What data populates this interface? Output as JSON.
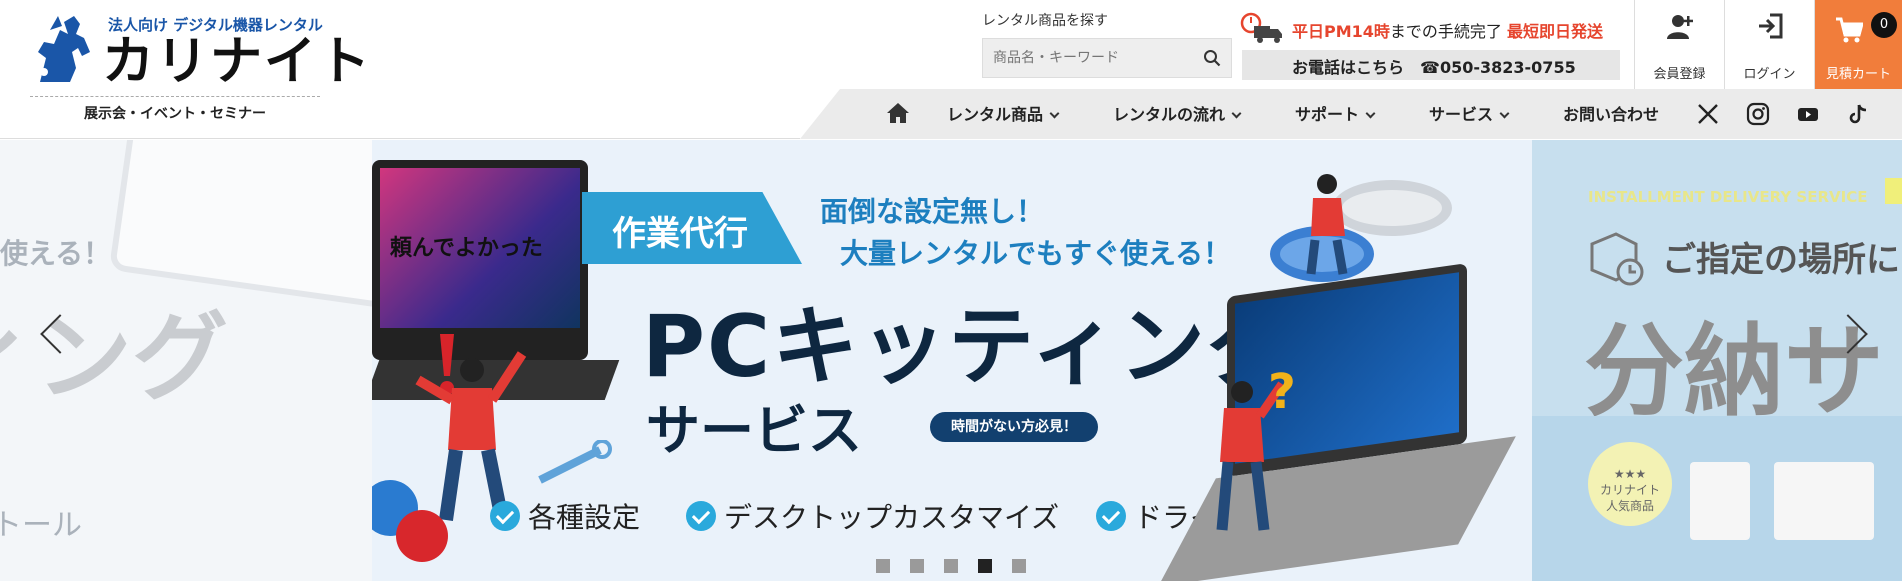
{
  "header": {
    "logo_tagline": "法人向け デジタル機器レンタル",
    "logo_name": "カリナイト",
    "logo_sub": "展示会・イベント・セミナー",
    "search": {
      "label": "レンタル商品を探す",
      "placeholder": "商品名・キーワード"
    },
    "shipping": {
      "part1": "平日PM14時",
      "part2": "までの手続完了",
      "part3": "最短即日発送"
    },
    "phone": {
      "label": "お電話はこちら",
      "number": "☎050-3823-0755"
    },
    "buttons": {
      "register": "会員登録",
      "login": "ログイン",
      "cart": "見積カート",
      "cart_count": "0"
    }
  },
  "nav": {
    "items": [
      "レンタル商品",
      "レンタルの流れ",
      "サポート",
      "サービス",
      "お問い合わせ"
    ],
    "social": [
      "x-icon",
      "instagram-icon",
      "youtube-icon",
      "tiktok-icon"
    ]
  },
  "slider": {
    "left": {
      "text_top": "使える！",
      "text_big": "ィング",
      "text_bottom": "トール"
    },
    "main": {
      "laptop_text": "頼んでよかった",
      "ribbon": "作業代行",
      "sub1": "面倒な設定無し！",
      "sub2": "大量レンタルでもすぐ使える！",
      "title": "PCキッティング",
      "title2": "サービス",
      "pill": "時間がない方必見！",
      "features": [
        "各種設定",
        "デスクトップカスタマイズ",
        "ドライバインストール"
      ]
    },
    "right": {
      "eyebrow": "INSTALLMENT DELIVERY SERVICE",
      "line1": "ご指定の場所に",
      "big": "分納サ",
      "badge_stars": "★★★",
      "badge_line1": "カリナイト",
      "badge_line2": "人気商品"
    },
    "dot_count": 5,
    "active_dot": 4
  },
  "colors": {
    "accent_orange": "#f17d3b",
    "accent_red": "#e6452e",
    "brand_blue": "#1a56a8",
    "ribbon_blue": "#2e9fd3",
    "navy": "#0e2740"
  }
}
